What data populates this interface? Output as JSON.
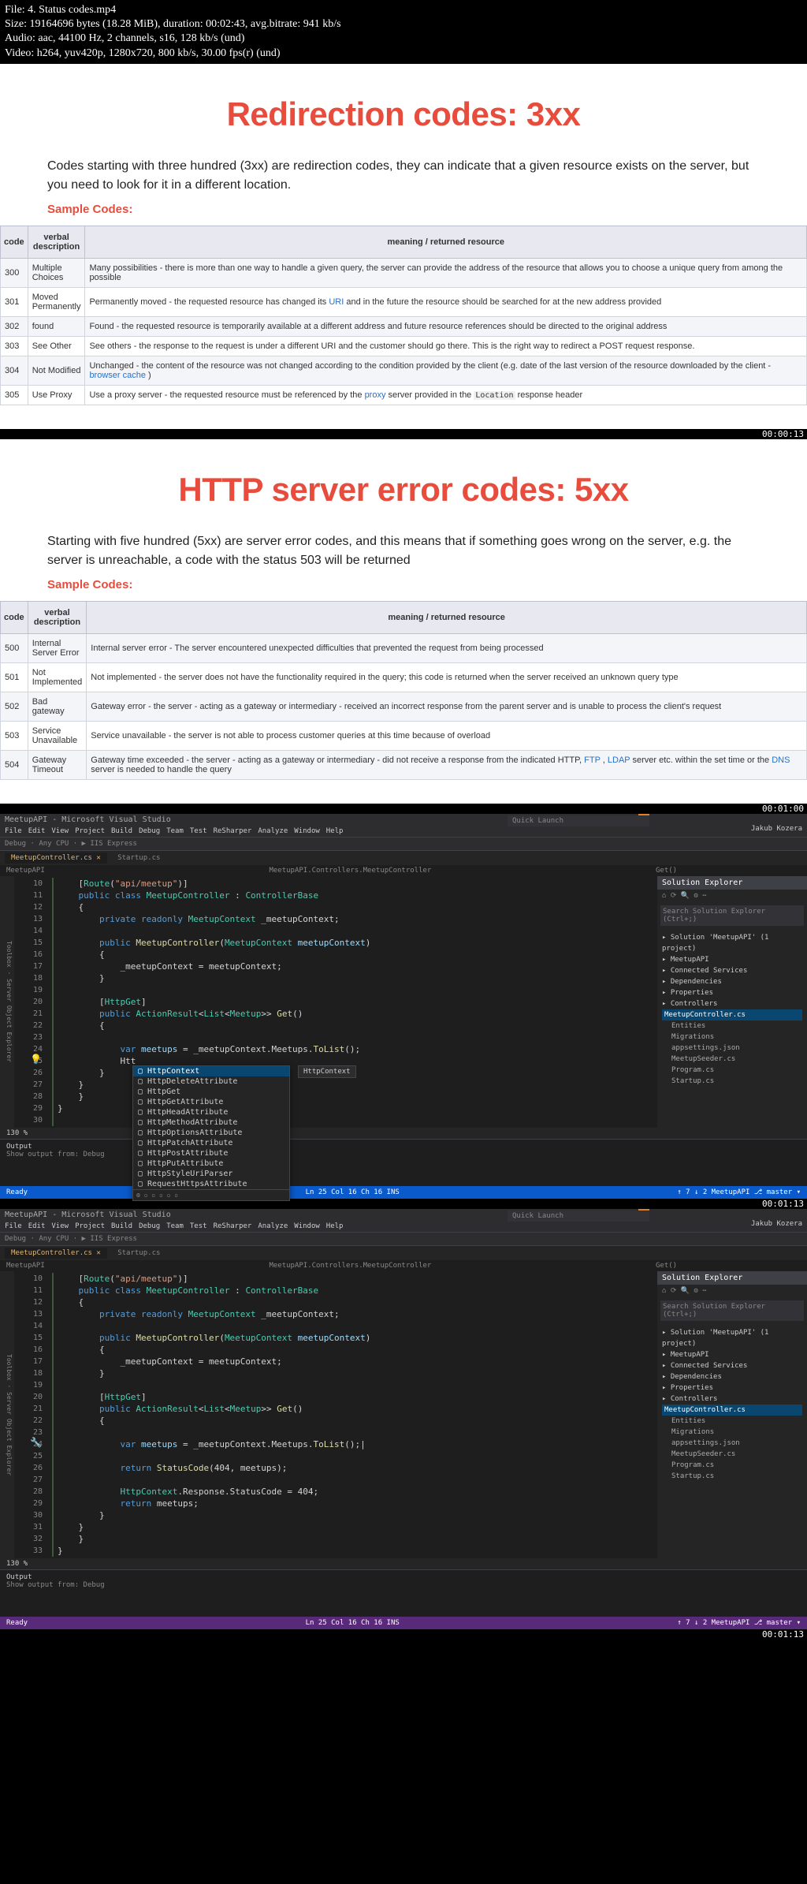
{
  "meta": {
    "file": "File: 4. Status codes.mp4",
    "size": "Size: 19164696 bytes (18.28 MiB), duration: 00:02:43, avg.bitrate: 941 kb/s",
    "audio": "Audio: aac, 44100 Hz, 2 channels, s16, 128 kb/s (und)",
    "video": "Video: h264, yuv420p, 1280x720, 800 kb/s, 30.00 fps(r) (und)"
  },
  "slide1": {
    "title": "Redirection codes: 3xx",
    "intro": "Codes starting with three hundred (3xx) are redirection codes, they can indicate that a given resource exists on the server, but you need to look for it in a different location.",
    "sample": "Sample Codes:",
    "th": {
      "code": "code",
      "verbal": "verbal description",
      "meaning": "meaning / returned resource"
    },
    "rows": [
      {
        "code": "300",
        "verbal": "Multiple Choices",
        "meaning": "Many possibilities - there is more than one way to handle a given query, the server can provide the address of the resource that allows you to choose a unique query from among the possible"
      },
      {
        "code": "301",
        "verbal": "Moved Permanently",
        "meaning_pre": "Permanently moved - the requested resource has changed its ",
        "link1": "URI",
        "meaning_post": " and in the future the resource should be searched for at the new address provided"
      },
      {
        "code": "302",
        "verbal": "found",
        "meaning": "Found - the requested resource is temporarily available at a different address and future resource references should be directed to the original address"
      },
      {
        "code": "303",
        "verbal": "See Other",
        "meaning": "See others - the response to the request is under a different URI and the customer should go there. This is the right way to redirect a POST request response."
      },
      {
        "code": "304",
        "verbal": "Not Modified",
        "meaning_pre": "Unchanged - the content of the resource was not changed according to the condition provided by the client (e.g. date of the last version of the resource downloaded by the client - ",
        "link1": "browser cache",
        "meaning_post": " )"
      },
      {
        "code": "305",
        "verbal": "Use Proxy",
        "meaning_pre": "Use a proxy server - the requested resource must be referenced by the ",
        "link1": "proxy",
        "meaning_mid": " server provided in the ",
        "mono": "Location",
        "meaning_post": " response header"
      }
    ],
    "ts": "00:00:13"
  },
  "slide2": {
    "title": "HTTP server error codes: 5xx",
    "intro": "Starting with five hundred (5xx) are server error codes, and this means that if something goes wrong on the server, e.g. the server is unreachable, a code with the status 503 will be returned",
    "sample": "Sample Codes:",
    "th": {
      "code": "code",
      "verbal": "verbal description",
      "meaning": "meaning / returned resource"
    },
    "rows": [
      {
        "code": "500",
        "verbal": "Internal Server Error",
        "meaning": "Internal server error - The server encountered unexpected difficulties that prevented the request from being processed"
      },
      {
        "code": "501",
        "verbal": "Not Implemented",
        "meaning": "Not implemented - the server does not have the functionality required in the query; this code is returned when the server received an unknown query type"
      },
      {
        "code": "502",
        "verbal": "Bad gateway",
        "meaning": "Gateway error - the server - acting as a gateway or intermediary - received an incorrect response from the parent server and is unable to process the client's request"
      },
      {
        "code": "503",
        "verbal": "Service Unavailable",
        "meaning": "Service unavailable - the server is not able to process customer queries at this time because of overload"
      },
      {
        "code": "504",
        "verbal": "Gateway Timeout",
        "meaning_pre": "Gateway time exceeded - the server - acting as a gateway or intermediary - did not receive a response from the indicated HTTP, ",
        "link1": "FTP",
        "meaning_mid": " , ",
        "link2": "LDAP",
        "meaning_mid2": " server etc. within the set time or the ",
        "link3": "DNS",
        "meaning_post": " server is needed to handle the query"
      }
    ],
    "ts": "00:01:00"
  },
  "vs": {
    "title": "MeetupAPI - Microsoft Visual Studio",
    "quick_launch": "Quick Launch",
    "user": "Jakub Kozera",
    "menu": [
      "File",
      "Edit",
      "View",
      "Project",
      "Build",
      "Debug",
      "Team",
      "Test",
      "ReSharper",
      "Analyze",
      "Window",
      "Help"
    ],
    "toolbar": "Debug · Any CPU · ▶ IIS Express",
    "tab_active": "MeetupController.cs",
    "tab_other": "Startup.cs",
    "tab_left": "MeetupAPI",
    "crumb": "MeetupAPI.Controllers.MeetupController",
    "crumb_right": "Get()",
    "se": {
      "title": "Solution Explorer",
      "search": "Search Solution Explorer (Ctrl+;)",
      "sol": "Solution 'MeetupAPI' (1 project)",
      "proj": "MeetupAPI",
      "items": [
        "Connected Services",
        "Dependencies",
        "Properties",
        "Controllers"
      ],
      "controller_file": "MeetupController.cs",
      "items2": [
        "Entities",
        "Migrations",
        "appsettings.json",
        "MeetupSeeder.cs",
        "Program.cs",
        "Startup.cs"
      ]
    },
    "output_label": "Output",
    "show_output": "Show output from:  Debug",
    "status": {
      "ready": "Ready",
      "pos": "Ln 25    Col 16    Ch 16    INS",
      "right": "↑ 7   ↓ 2   MeetupAPI   ⎇ master ▾"
    },
    "ts1": "00:01:13",
    "ts2": "00:01:13"
  },
  "code1": {
    "lines": [
      {
        "n": 10,
        "raw": "    [",
        "parts": [
          [
            "type",
            "Route"
          ],
          [
            "",
            ""
          ],
          [
            "",
            "("
          ],
          [
            "str",
            "\"api/meetup\""
          ],
          [
            "",
            ")]"
          ]
        ]
      },
      {
        "n": 11,
        "raw": "    ",
        "parts": [
          [
            "kw",
            "public class "
          ],
          [
            "type",
            "MeetupController"
          ],
          [
            "",
            " : "
          ],
          [
            "type",
            "ControllerBase"
          ]
        ]
      },
      {
        "n": 12,
        "raw": "    {"
      },
      {
        "n": 13,
        "raw": "        ",
        "parts": [
          [
            "kw",
            "private readonly "
          ],
          [
            "type",
            "MeetupContext"
          ],
          [
            "",
            " _meetupContext;"
          ]
        ]
      },
      {
        "n": 14,
        "raw": ""
      },
      {
        "n": 15,
        "raw": "        ",
        "parts": [
          [
            "kw",
            "public "
          ],
          [
            "method",
            "MeetupController"
          ],
          [
            "",
            "("
          ],
          [
            "type",
            "MeetupContext"
          ],
          [
            "",
            " "
          ],
          [
            "ident",
            "meetupContext"
          ],
          [
            "",
            ")"
          ]
        ]
      },
      {
        "n": 16,
        "raw": "        {"
      },
      {
        "n": 17,
        "raw": "            _meetupContext = meetupContext;"
      },
      {
        "n": 18,
        "raw": "        }"
      },
      {
        "n": 19,
        "raw": ""
      },
      {
        "n": 20,
        "raw": "        [",
        "parts": [
          [
            "type",
            "HttpGet"
          ],
          [
            "",
            "]"
          ]
        ]
      },
      {
        "n": 21,
        "raw": "        ",
        "parts": [
          [
            "kw",
            "public "
          ],
          [
            "type",
            "ActionResult"
          ],
          [
            "",
            "<"
          ],
          [
            "type",
            "List"
          ],
          [
            "",
            "<"
          ],
          [
            "type",
            "Meetup"
          ],
          [
            "",
            ">> "
          ],
          [
            "method",
            "Get"
          ],
          [
            "",
            "()"
          ]
        ]
      },
      {
        "n": 22,
        "raw": "        {"
      },
      {
        "n": 23,
        "raw": ""
      },
      {
        "n": 24,
        "raw": "            ",
        "parts": [
          [
            "kw",
            "var "
          ],
          [
            "ident",
            "meetups"
          ],
          [
            "",
            " = _meetupContext.Meetups."
          ],
          [
            "method",
            "ToList"
          ],
          [
            "",
            "();"
          ]
        ]
      },
      {
        "n": 25,
        "raw": "            Htt"
      },
      {
        "n": 26,
        "raw": "        }"
      },
      {
        "n": 27,
        "raw": "    }"
      },
      {
        "n": 28,
        "raw": "    }"
      },
      {
        "n": 29,
        "raw": "}"
      },
      {
        "n": 30,
        "raw": ""
      }
    ],
    "intellisense": {
      "sel": "HttpContext",
      "tip": "HttpContext",
      "items": [
        "HttpDeleteAttribute",
        "HttpGet",
        "HttpGetAttribute",
        "HttpHeadAttribute",
        "HttpMethodAttribute",
        "HttpOptionsAttribute",
        "HttpPatchAttribute",
        "HttpPostAttribute",
        "HttpPutAttribute",
        "HttpStyleUriParser",
        "RequestHttpsAttribute"
      ]
    }
  },
  "code2": {
    "lines": [
      {
        "n": 10,
        "raw": "    [",
        "parts": [
          [
            "type",
            "Route"
          ],
          [
            "",
            "("
          ],
          [
            "str",
            "\"api/meetup\""
          ],
          [
            "",
            ")]"
          ]
        ]
      },
      {
        "n": 11,
        "raw": "    ",
        "parts": [
          [
            "kw",
            "public class "
          ],
          [
            "type",
            "MeetupController"
          ],
          [
            "",
            " : "
          ],
          [
            "type",
            "ControllerBase"
          ]
        ]
      },
      {
        "n": 12,
        "raw": "    {"
      },
      {
        "n": 13,
        "raw": "        ",
        "parts": [
          [
            "kw",
            "private readonly "
          ],
          [
            "type",
            "MeetupContext"
          ],
          [
            "",
            " _meetupContext;"
          ]
        ]
      },
      {
        "n": 14,
        "raw": ""
      },
      {
        "n": 15,
        "raw": "        ",
        "parts": [
          [
            "kw",
            "public "
          ],
          [
            "method",
            "MeetupController"
          ],
          [
            "",
            "("
          ],
          [
            "type",
            "MeetupContext"
          ],
          [
            "",
            " "
          ],
          [
            "ident",
            "meetupContext"
          ],
          [
            "",
            ")"
          ]
        ]
      },
      {
        "n": 16,
        "raw": "        {"
      },
      {
        "n": 17,
        "raw": "            _meetupContext = meetupContext;"
      },
      {
        "n": 18,
        "raw": "        }"
      },
      {
        "n": 19,
        "raw": ""
      },
      {
        "n": 20,
        "raw": "        [",
        "parts": [
          [
            "type",
            "HttpGet"
          ],
          [
            "",
            "]"
          ]
        ]
      },
      {
        "n": 21,
        "raw": "        ",
        "parts": [
          [
            "kw",
            "public "
          ],
          [
            "type",
            "ActionResult"
          ],
          [
            "",
            "<"
          ],
          [
            "type",
            "List"
          ],
          [
            "",
            "<"
          ],
          [
            "type",
            "Meetup"
          ],
          [
            "",
            ">> "
          ],
          [
            "method",
            "Get"
          ],
          [
            "",
            "()"
          ]
        ]
      },
      {
        "n": 22,
        "raw": "        {"
      },
      {
        "n": 23,
        "raw": ""
      },
      {
        "n": 24,
        "raw": "            ",
        "parts": [
          [
            "kw",
            "var "
          ],
          [
            "ident",
            "meetups"
          ],
          [
            "",
            " = _meetupContext.Meetups."
          ],
          [
            "method",
            "ToList"
          ],
          [
            "",
            "();|"
          ]
        ]
      },
      {
        "n": 25,
        "raw": ""
      },
      {
        "n": 26,
        "raw": "            ",
        "parts": [
          [
            "kw",
            "return "
          ],
          [
            "method",
            "StatusCode"
          ],
          [
            "",
            "(404, meetups);"
          ]
        ]
      },
      {
        "n": 27,
        "raw": ""
      },
      {
        "n": 28,
        "raw": "            ",
        "parts": [
          [
            "type",
            "HttpContext"
          ],
          [
            "",
            ".Response.StatusCode = 404;"
          ]
        ]
      },
      {
        "n": 29,
        "raw": "            ",
        "parts": [
          [
            "kw",
            "return "
          ],
          [
            "",
            "meetups;"
          ]
        ]
      },
      {
        "n": 30,
        "raw": "        }"
      },
      {
        "n": 31,
        "raw": "    }"
      },
      {
        "n": 32,
        "raw": "    }"
      },
      {
        "n": 33,
        "raw": "}"
      }
    ]
  }
}
